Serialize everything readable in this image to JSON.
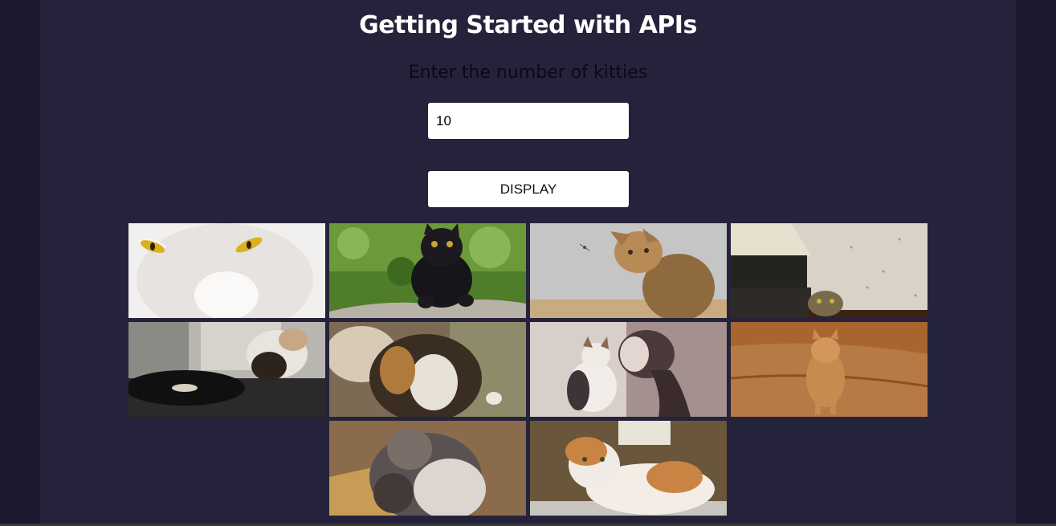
{
  "page": {
    "title": "Getting Started with APIs",
    "prompt": "Enter the number of kitties"
  },
  "form": {
    "count_value": "10",
    "display_label": "DISPLAY"
  },
  "gallery": {
    "images": [
      {
        "name": "white-cat-yellow-eyes-image"
      },
      {
        "name": "black-cat-on-rock-image"
      },
      {
        "name": "tabby-cat-watching-insect-image"
      },
      {
        "name": "cat-peeking-behind-boxes-image"
      },
      {
        "name": "cat-on-record-player-image"
      },
      {
        "name": "calico-cat-close-up-image"
      },
      {
        "name": "cat-and-girl-image"
      },
      {
        "name": "orange-cat-walking-image"
      },
      {
        "name": "fluffy-cat-looking-up-image"
      },
      {
        "name": "orange-white-cat-lying-image"
      }
    ]
  }
}
